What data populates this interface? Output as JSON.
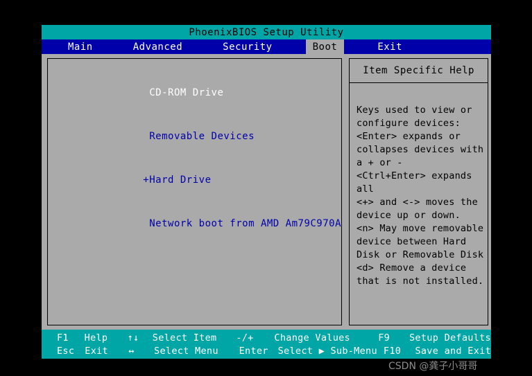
{
  "title": "PhoenixBIOS Setup Utility",
  "menu": {
    "items": [
      {
        "label": "Main",
        "active": false
      },
      {
        "label": "Advanced",
        "active": false
      },
      {
        "label": "Security",
        "active": false
      },
      {
        "label": "Boot",
        "active": true
      },
      {
        "label": "Exit",
        "active": false
      }
    ]
  },
  "boot_order": {
    "items": [
      {
        "label": " CD-ROM Drive",
        "selected": true
      },
      {
        "label": " Removable Devices",
        "selected": false
      },
      {
        "label": "+Hard Drive",
        "selected": false
      },
      {
        "label": " Network boot from AMD Am79C970A",
        "selected": false
      }
    ]
  },
  "help": {
    "title": "Item Specific Help",
    "lines": [
      "Keys used to view or",
      "configure devices:",
      "<Enter> expands or",
      "collapses devices with",
      "a + or -",
      "<Ctrl+Enter> expands",
      "all",
      "<+> and <-> moves the",
      "device up or down.",
      "<n> May move removable",
      "device between Hard",
      "Disk or Removable Disk",
      "<d> Remove a device",
      "that is not installed."
    ]
  },
  "footer": {
    "row1": [
      {
        "key": "F1",
        "label": "Help"
      },
      {
        "key": "↑↓",
        "label": "Select Item"
      },
      {
        "key": "-/+",
        "label": "Change Values"
      },
      {
        "key": "F9",
        "label": "Setup Defaults"
      }
    ],
    "row2": [
      {
        "key": "Esc",
        "label": "Exit"
      },
      {
        "key": "↔",
        "label": "Select Menu"
      },
      {
        "key": "Enter",
        "label": "Select ▶ Sub-Menu"
      },
      {
        "key": "F10",
        "label": "Save and Exit"
      }
    ]
  },
  "watermark": "CSDN @龚子小哥哥",
  "colors": {
    "title_bar": "#00a6a6",
    "menu_bar": "#0000aa",
    "panel_bg": "#aaaaaa",
    "text_blue": "#0000aa",
    "text_white": "#ffffff",
    "footer_bg": "#00a6a6"
  }
}
